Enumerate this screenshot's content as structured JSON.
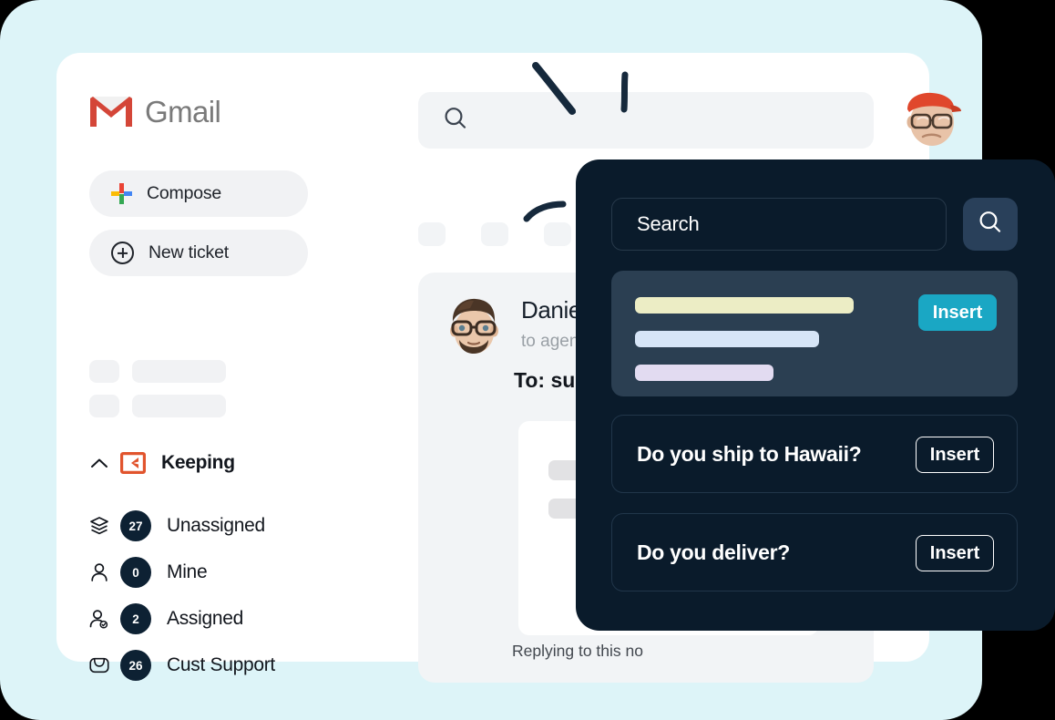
{
  "theme": {
    "page_bg": "#000000",
    "frame_bg": "#ddf4f8",
    "card_bg": "#ffffff",
    "panel_bg": "#0a1b2b",
    "accent_teal": "#1aa7c4",
    "badge_navy": "#0d2133",
    "keeping_orange": "#e1542d",
    "skeleton_grey": "#f1f2f4"
  },
  "sidebar": {
    "brand": {
      "label": "Gmail",
      "icon": "gmail-logo-icon"
    },
    "compose": {
      "label": "Compose",
      "icon": "google-plus-icon"
    },
    "new_ticket": {
      "label": "New ticket",
      "icon": "plus-circle-icon"
    },
    "group": {
      "label": "Keeping",
      "icon": "keeping-logo-icon",
      "chevron": "chevron-up-icon"
    },
    "items": [
      {
        "label": "Unassigned",
        "count": "27",
        "icon": "layers-icon"
      },
      {
        "label": "Mine",
        "count": "0",
        "icon": "person-icon"
      },
      {
        "label": "Assigned",
        "count": "2",
        "icon": "person-check-icon"
      },
      {
        "label": "Cust Support",
        "count": "26",
        "icon": "inbox-icon"
      }
    ]
  },
  "main": {
    "search": {
      "placeholder": "",
      "icon": "search-icon"
    },
    "email": {
      "from": "Daniel LaRu",
      "to_agents": "to agents",
      "to_line": "To: support@",
      "footer": "Replying to this no",
      "avatar": "memoji-avatar"
    },
    "header_avatar": "user-memoji-avatar"
  },
  "dark_panel": {
    "search": {
      "value": "Search",
      "button_icon": "search-icon"
    },
    "highlight_card": {
      "insert_label": "Insert"
    },
    "snippets": [
      {
        "question": "Do you ship to Hawaii?",
        "insert_label": "Insert"
      },
      {
        "question": "Do you deliver?",
        "insert_label": "Insert"
      }
    ]
  }
}
